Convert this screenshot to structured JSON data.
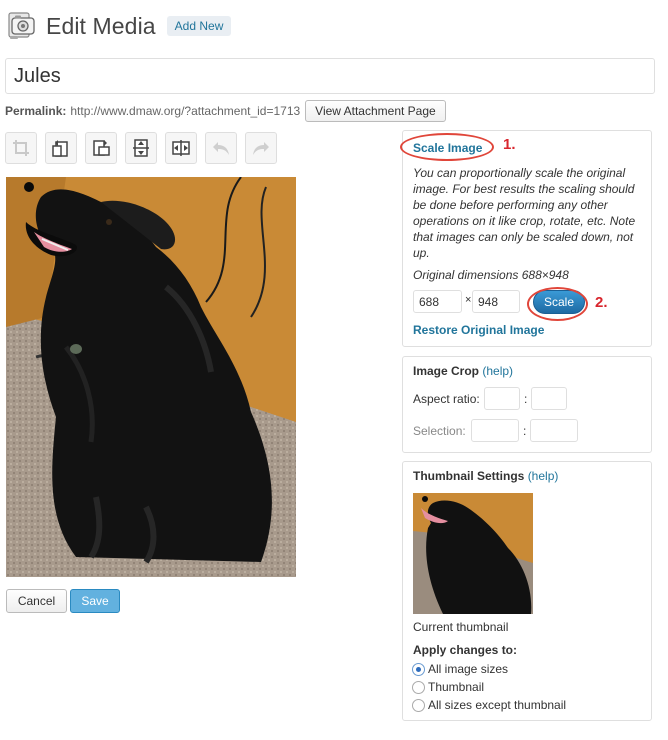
{
  "header": {
    "title": "Edit Media",
    "add_new": "Add New",
    "icon": "media-camera-icon"
  },
  "title_field": {
    "value": "Jules"
  },
  "permalink": {
    "label": "Permalink:",
    "url": "http://www.dmaw.org/?attachment_id=1713",
    "view_button": "View Attachment Page"
  },
  "toolbar": {
    "tools": [
      {
        "name": "crop-icon",
        "enabled": false
      },
      {
        "name": "rotate-left-icon",
        "enabled": true
      },
      {
        "name": "rotate-right-icon",
        "enabled": true
      },
      {
        "name": "flip-vertical-icon",
        "enabled": true
      },
      {
        "name": "flip-horizontal-icon",
        "enabled": true
      },
      {
        "name": "undo-icon",
        "enabled": false
      },
      {
        "name": "redo-icon",
        "enabled": false
      }
    ]
  },
  "actions": {
    "cancel": "Cancel",
    "save": "Save"
  },
  "scale_panel": {
    "title": "Scale Image",
    "annotation_1": "1.",
    "description": "You can proportionally scale the original image. For best results the scaling should be done before performing any other operations on it like crop, rotate, etc. Note that images can only be scaled down, not up.",
    "original_dimensions": "Original dimensions 688×948",
    "width_value": "688",
    "separator": "×",
    "height_value": "948",
    "scale_button": "Scale",
    "annotation_2": "2.",
    "restore_link": "Restore Original Image"
  },
  "crop_panel": {
    "title": "Image Crop",
    "help": "(help)",
    "aspect_label": "Aspect ratio:",
    "selection_label": "Selection:",
    "colon": ":"
  },
  "thumbnail_panel": {
    "title": "Thumbnail Settings",
    "help": "(help)",
    "current_label": "Current thumbnail",
    "apply_label": "Apply changes to:",
    "options": [
      {
        "label": "All image sizes",
        "checked": true
      },
      {
        "label": "Thumbnail",
        "checked": false
      },
      {
        "label": "All sizes except thumbnail",
        "checked": false
      }
    ]
  },
  "colors": {
    "link": "#21759b",
    "annotation_red": "#d8262e",
    "scale_button": "#2a7fbf",
    "save_button": "#62b1df"
  }
}
